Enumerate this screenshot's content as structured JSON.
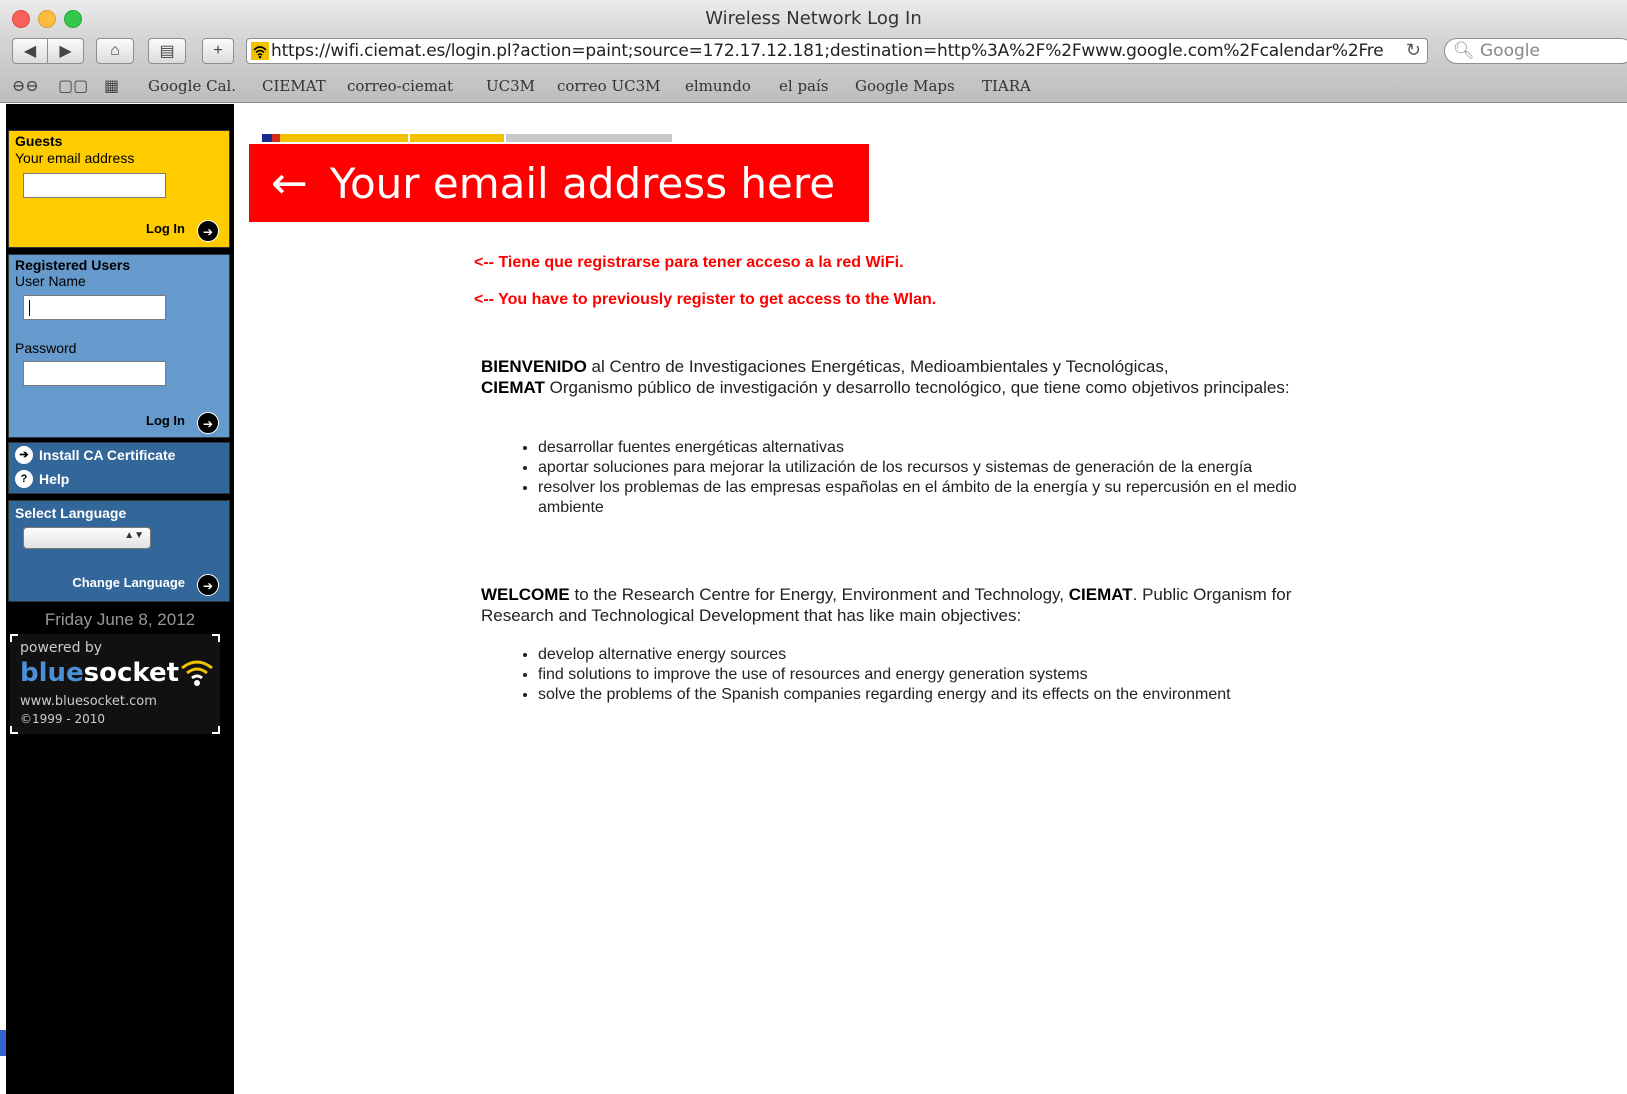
{
  "window": {
    "title": "Wireless Network Log In"
  },
  "toolbar": {
    "url": "https://wifi.ciemat.es/login.pl?action=paint;source=172.17.12.181;destination=http%3A%2F%2Fwww.google.com%2Fcalendar%2Fre",
    "search_placeholder": "Google",
    "plus": "+"
  },
  "bookmarks": [
    "Google Cal.",
    "CIEMAT",
    "correo-ciemat",
    "UC3M",
    "correo UC3M",
    "elmundo",
    "el país",
    "Google Maps",
    "TIARA"
  ],
  "sidebar": {
    "guests": {
      "title": "Guests",
      "email_label": "Your email address",
      "login": "Log In"
    },
    "registered": {
      "title": "Registered Users",
      "user_label": "User Name",
      "password_label": "Password",
      "login": "Log In"
    },
    "links": {
      "install": "Install CA Certificate",
      "help": "Help"
    },
    "language": {
      "title": "Select Language",
      "change": "Change Language"
    },
    "date": "Friday June 8, 2012",
    "powered": {
      "by": "powered by",
      "brand_a": "blue",
      "brand_b": "socket",
      "www": "www.bluesocket.com",
      "copy": "©1999 - 2010"
    }
  },
  "main": {
    "callout": {
      "arrow": "←",
      "text": "Your email address here"
    },
    "note_es": "<-- Tiene que registrarse para tener acceso a la red WiFi.",
    "note_en": "<-- You have to previously register to get access to the Wlan.",
    "es": {
      "bold1": "BIENVENIDO",
      "t1": " al Centro de Investigaciones Energéticas, Medioambientales y Tecnológicas,",
      "bold2": "CIEMAT",
      "t2": " Organismo público de investigación y desarrollo tecnológico, que tiene como objetivos principales:",
      "items": [
        "desarrollar fuentes energéticas alternativas",
        "aportar soluciones para mejorar la utilización de los recursos y sistemas de generación de la energía",
        "resolver los problemas de las empresas españolas en el ámbito de la energía y su repercusión en el medio ambiente"
      ]
    },
    "en": {
      "bold1": "WELCOME",
      "t1": " to the Research Centre for Energy, Environment and Technology, ",
      "bold2": "CIEMAT",
      "t2": ". Public Organism for Research and Technological Development that has like main objectives:",
      "items": [
        "develop alternative energy sources",
        "find solutions to improve the use of resources and energy generation systems",
        "solve the problems of the Spanish companies regarding energy and its effects on the environment"
      ]
    }
  },
  "colors": {
    "guests_bg": "#ffcc00",
    "registered_bg": "#6699cc",
    "dark_blue": "#336699",
    "callout_red": "#ff0000"
  }
}
